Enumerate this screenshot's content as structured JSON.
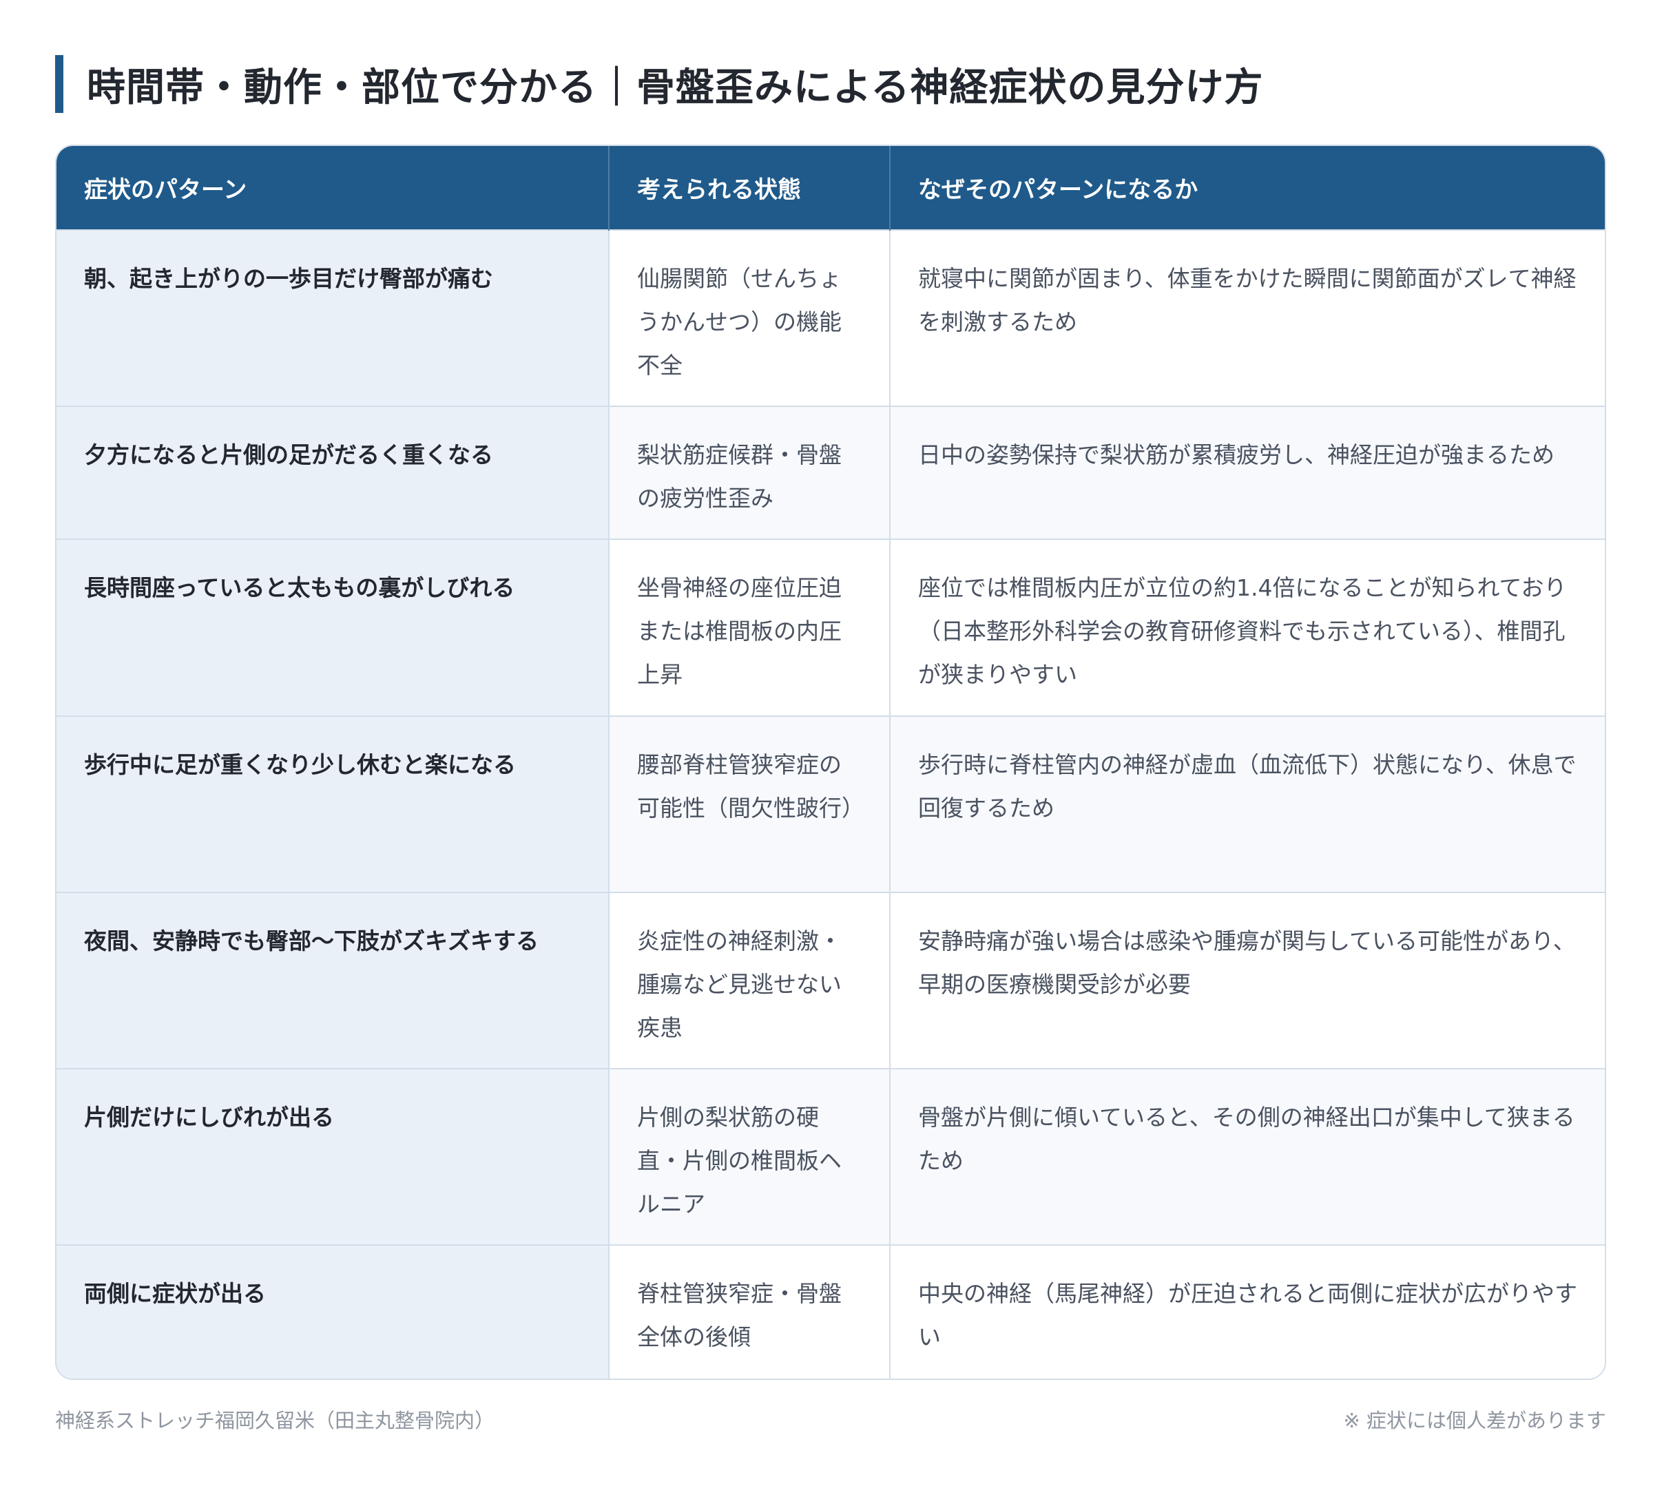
{
  "title": "時間帯・動作・部位で分かる｜骨盤歪みによる神経症状の見分け方",
  "table": {
    "headers": [
      "症状のパターン",
      "考えられる状態",
      "なぜそのパターンになるか"
    ],
    "rows": [
      {
        "pattern": "朝、起き上がりの一歩目だけ臀部が痛む",
        "state": "仙腸関節（せんちょうかんせつ）の機能不全",
        "reason": "就寝中に関節が固まり、体重をかけた瞬間に関節面がズレて神経を刺激するため"
      },
      {
        "pattern": "夕方になると片側の足がだるく重くなる",
        "state": "梨状筋症候群・骨盤の疲労性歪み",
        "reason": "日中の姿勢保持で梨状筋が累積疲労し、神経圧迫が強まるため"
      },
      {
        "pattern": "長時間座っていると太ももの裏がしびれる",
        "state": "坐骨神経の座位圧迫または椎間板の内圧上昇",
        "reason": "座位では椎間板内圧が立位の約1.4倍になることが知られており（日本整形外科学会の教育研修資料でも示されている）、椎間孔が狭まりやすい"
      },
      {
        "pattern": "歩行中に足が重くなり少し休むと楽になる",
        "state": "腰部脊柱管狭窄症の可能性（間欠性跛行）",
        "reason": "歩行時に脊柱管内の神経が虚血（血流低下）状態になり、休息で回復するため"
      },
      {
        "pattern": "夜間、安静時でも臀部〜下肢がズキズキする",
        "state": "炎症性の神経刺激・腫瘍など見逃せない疾患",
        "reason": "安静時痛が強い場合は感染や腫瘍が関与している可能性があり、早期の医療機関受診が必要"
      },
      {
        "pattern": "片側だけにしびれが出る",
        "state": "片側の梨状筋の硬直・片側の椎間板ヘルニア",
        "reason": "骨盤が片側に傾いていると、その側の神経出口が集中して狭まるため"
      },
      {
        "pattern": "両側に症状が出る",
        "state": "脊柱管狭窄症・骨盤全体の後傾",
        "reason": "中央の神経（馬尾神経）が圧迫されると両側に症状が広がりやすい"
      }
    ]
  },
  "footer": {
    "source": "神経系ストレッチ福岡久留米（田主丸整骨院内）",
    "note": "※ 症状には個人差があります"
  }
}
